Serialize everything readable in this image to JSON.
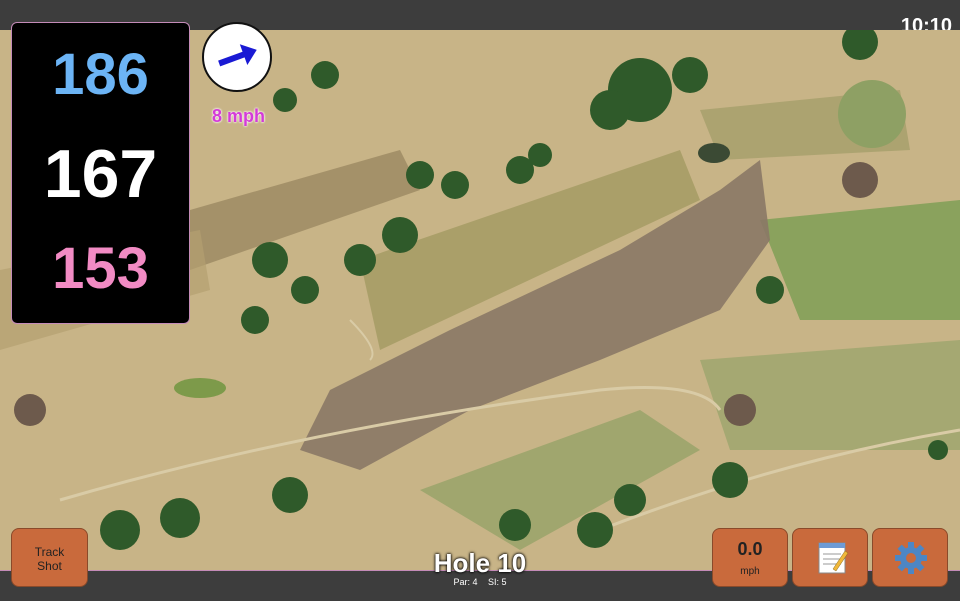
{
  "status": {
    "time": "10:10"
  },
  "distances": {
    "back": "186",
    "middle": "167",
    "front": "153"
  },
  "wind": {
    "speed_label": "8 mph",
    "direction_icon": "wind-arrow-icon",
    "color": "#d43bd8"
  },
  "buttons": {
    "track_shot": "Track Shot",
    "wind_value": "0.0",
    "wind_unit": "mph",
    "notes_icon": "notepad-icon",
    "settings_icon": "gear-icon"
  },
  "hole": {
    "title": "Hole 10",
    "par": "Par: 4",
    "si": "SI: 5"
  },
  "colors": {
    "back": "#6cb4f5",
    "middle": "#ffffff",
    "front": "#f28bc4",
    "button": "#c96a3c"
  }
}
